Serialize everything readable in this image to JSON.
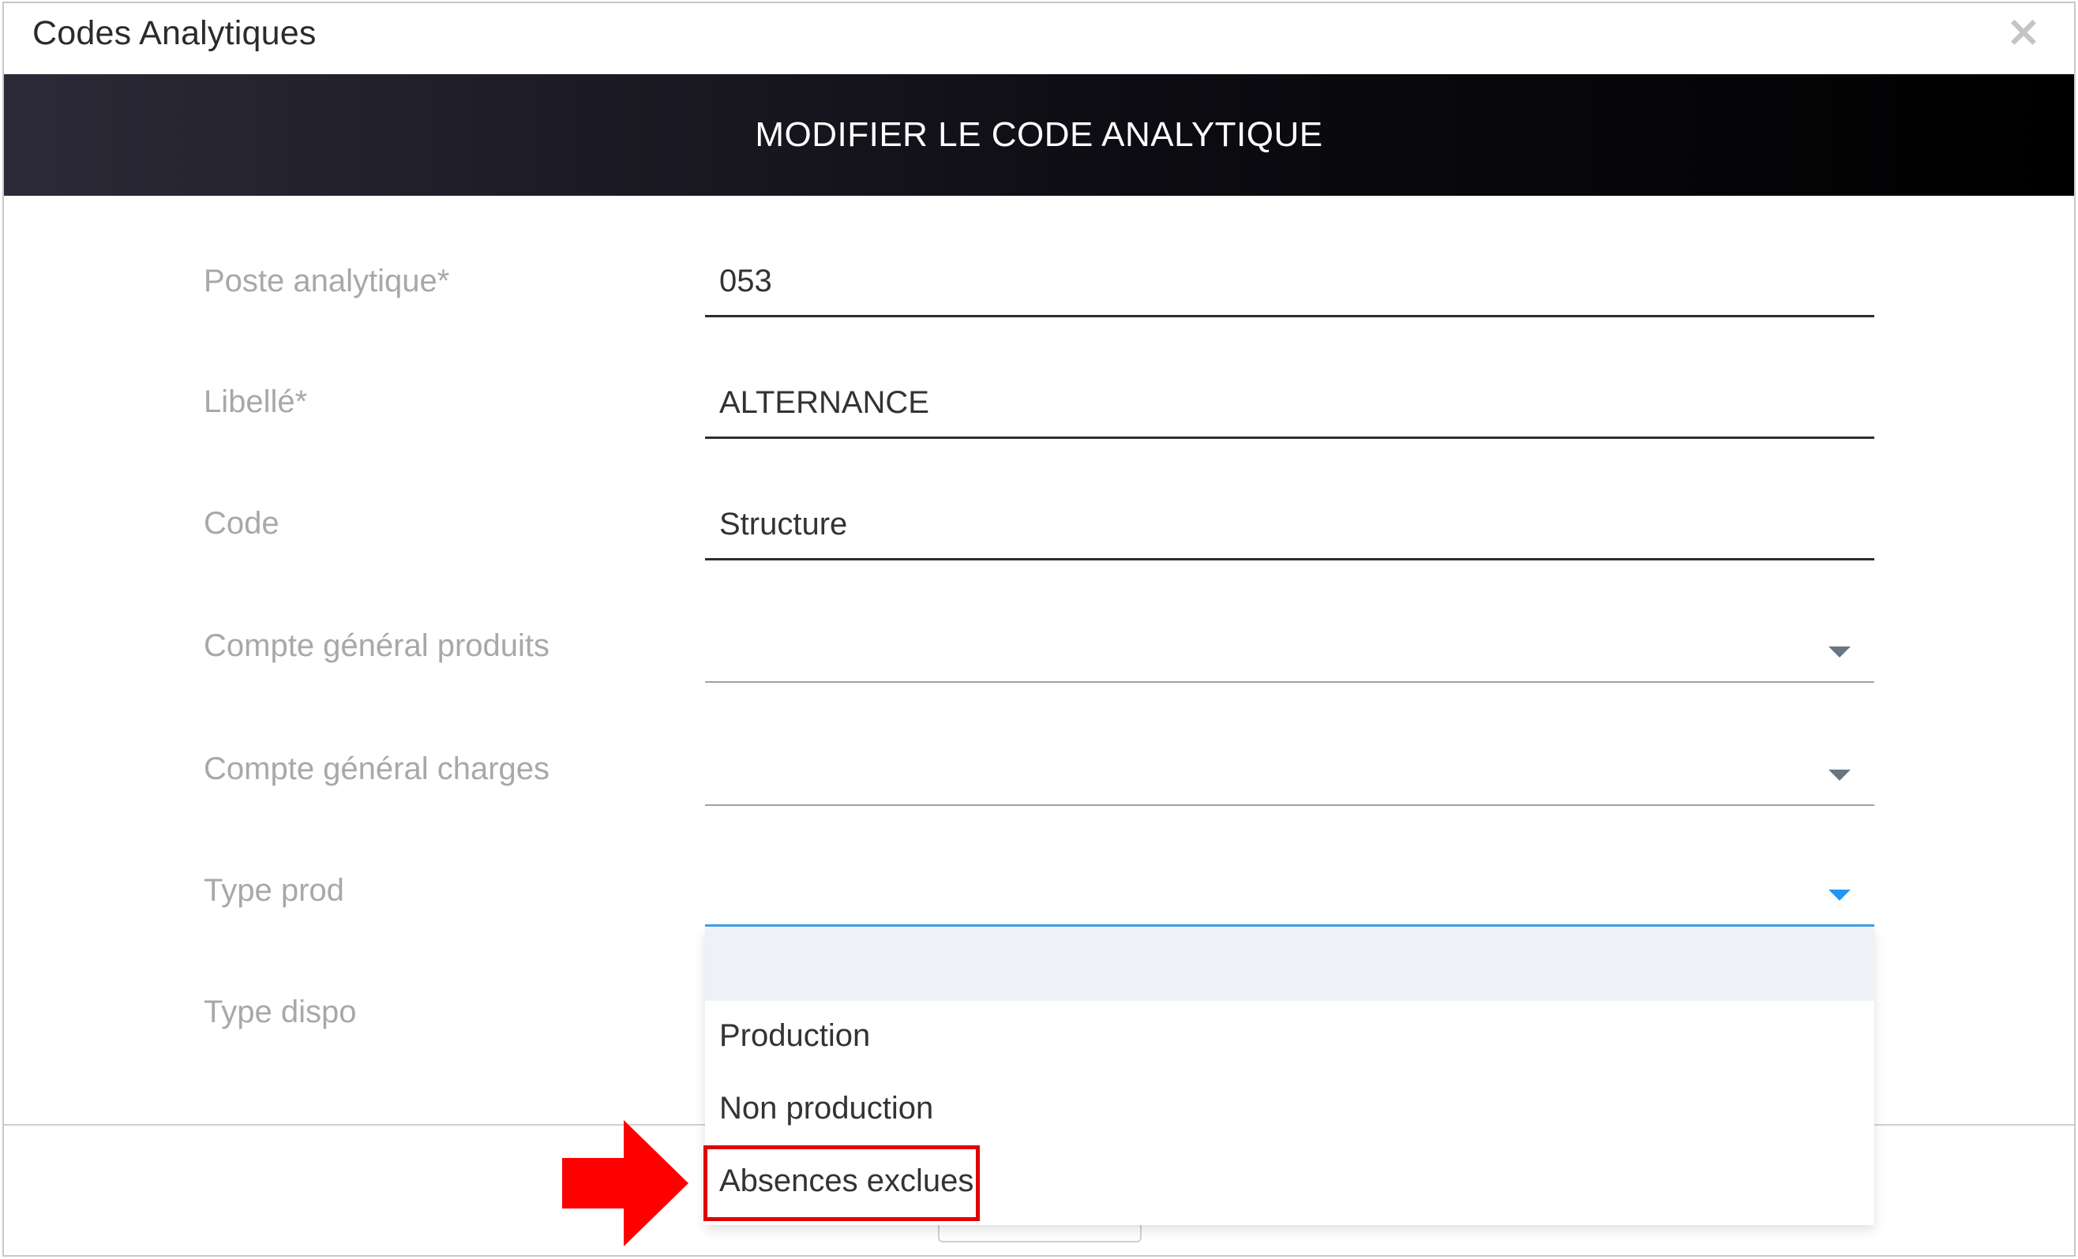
{
  "dialog": {
    "title": "Codes Analytiques",
    "close_glyph": "×",
    "banner_title": "MODIFIER LE CODE ANALYTIQUE"
  },
  "fields": [
    {
      "label": "Poste analytique*",
      "value": "053"
    },
    {
      "label": "Libellé*",
      "value": "ALTERNANCE"
    },
    {
      "label": "Code",
      "value": "Structure"
    },
    {
      "label": "Compte général produits",
      "value": ""
    },
    {
      "label": "Compte général charges",
      "value": ""
    },
    {
      "label": "Type prod",
      "value": ""
    },
    {
      "label": "Type dispo",
      "value": ""
    }
  ],
  "dropdown": {
    "options": [
      "",
      "Production",
      "Non production",
      "Absences exclues"
    ]
  },
  "colors": {
    "highlight": "#e00000",
    "active_underline": "#3aa0e8",
    "banner": "#000000"
  },
  "icons": [
    "close-icon",
    "chevron-down-icon",
    "red-arrow-annotation"
  ]
}
